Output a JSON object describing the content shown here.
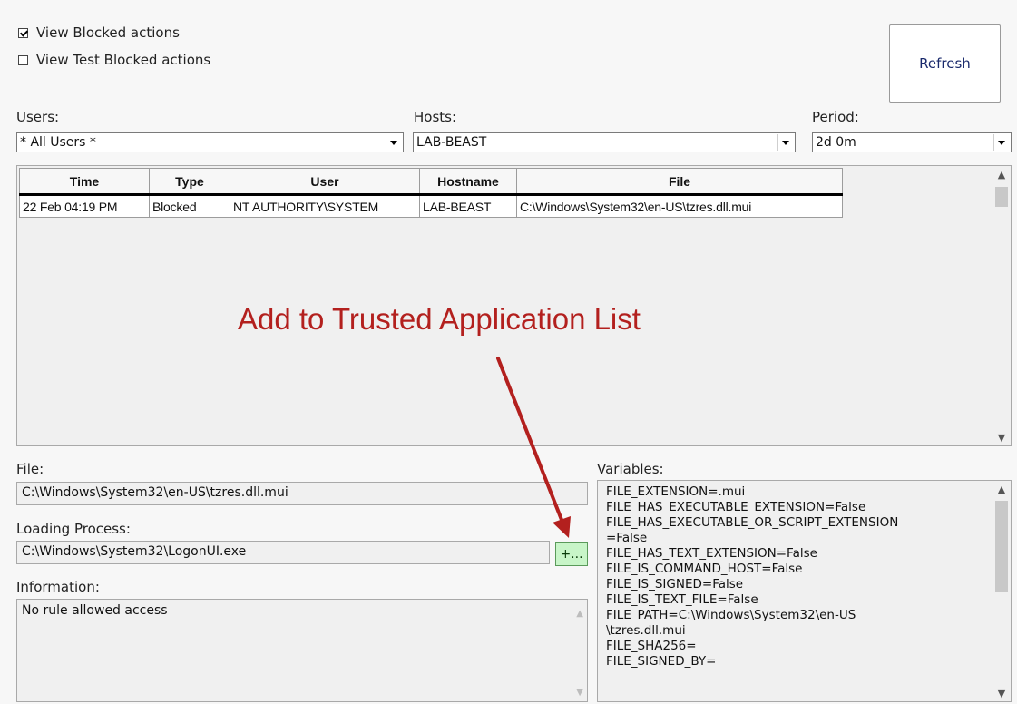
{
  "filters": {
    "view_blocked_label": "View Blocked actions",
    "view_blocked_checked": true,
    "view_test_blocked_label": "View Test Blocked actions",
    "view_test_blocked_checked": false
  },
  "toolbar": {
    "refresh_label": "Refresh"
  },
  "users": {
    "label": "Users:",
    "value": "* All Users *"
  },
  "hosts": {
    "label": "Hosts:",
    "value": "LAB-BEAST"
  },
  "period": {
    "label": "Period:",
    "value": "2d 0m"
  },
  "grid": {
    "columns": [
      "Time",
      "Type",
      "User",
      "Hostname",
      "File"
    ],
    "rows": [
      [
        "22 Feb 04:19 PM",
        "Blocked",
        "NT AUTHORITY\\SYSTEM",
        "LAB-BEAST",
        "C:\\Windows\\System32\\en-US\\tzres.dll.mui"
      ]
    ]
  },
  "annotation": {
    "text": "Add to Trusted Application List",
    "color": "#b3201e"
  },
  "details": {
    "file_label": "File:",
    "file_value": "C:\\Windows\\System32\\en-US\\tzres.dll.mui",
    "loading_process_label": "Loading Process:",
    "loading_process_value": "C:\\Windows\\System32\\LogonUI.exe",
    "add_button_label": "+...",
    "information_label": "Information:",
    "information_value": "No rule allowed access",
    "variables_label": "Variables:",
    "variables": [
      "FILE_EXTENSION=.mui",
      "FILE_HAS_EXECUTABLE_EXTENSION=False",
      "FILE_HAS_EXECUTABLE_OR_SCRIPT_EXTENSION",
      "=False",
      "FILE_HAS_TEXT_EXTENSION=False",
      "FILE_IS_COMMAND_HOST=False",
      "FILE_IS_SIGNED=False",
      "FILE_IS_TEXT_FILE=False",
      "FILE_PATH=C:\\Windows\\System32\\en-US",
      "\\tzres.dll.mui",
      "FILE_SHA256=",
      "FILE_SIGNED_BY="
    ]
  },
  "icons": {
    "dropdown": "chevron-down-icon",
    "scroll_up": "scroll-up-icon",
    "scroll_down": "scroll-down-icon",
    "checkbox": "checkbox-icon",
    "arrow": "red-arrow-icon"
  }
}
